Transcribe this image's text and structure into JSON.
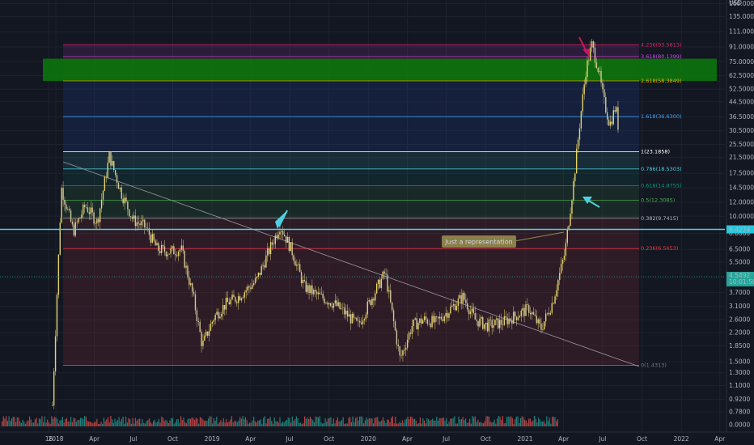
{
  "chart_data": {
    "type": "candlestick",
    "price_axis": {
      "scale": "log",
      "currency": "USD",
      "range": [
        0.72,
        200
      ],
      "tick_labels": [
        "160.0000",
        "135.0000",
        "111.0000",
        "91.0000",
        "75.0000",
        "62.5000",
        "52.5000",
        "44.5000",
        "36.5000",
        "30.5000",
        "25.5000",
        "21.5000",
        "17.5000",
        "14.5000",
        "12.0000",
        "10.0000",
        "8.0000",
        "6.5000",
        "5.5000",
        "4.5000",
        "3.7000",
        "3.1000",
        "2.6000",
        "2.2000",
        "1.8500",
        "1.5000",
        "1.3000",
        "1.1000",
        "0.9200",
        "0.7800",
        "0.0000"
      ],
      "current_price_label": "8.4274",
      "last_price_label": "4.5492",
      "countdown_label": "10:01:50"
    },
    "time_axis": {
      "labels": [
        "16",
        "2018",
        "Apr",
        "Jul",
        "Oct",
        "2019",
        "Apr",
        "Jul",
        "Oct",
        "2020",
        "Apr",
        "Jul",
        "Oct",
        "2021",
        "Apr",
        "Jul",
        "Oct",
        "2022",
        "Apr"
      ]
    },
    "fibonacci": [
      {
        "label": "0(1.4313)",
        "ratio": 0,
        "price": 1.4313,
        "color": "#787b86"
      },
      {
        "label": "0.236(6.5653)",
        "ratio": 0.236,
        "price": 6.5653,
        "color": "#f23645"
      },
      {
        "label": "0.382(9.7415)",
        "ratio": 0.382,
        "price": 9.7415,
        "color": "#b2b5be"
      },
      {
        "label": "0.5(12.3085)",
        "ratio": 0.5,
        "price": 12.3085,
        "color": "#4caf50"
      },
      {
        "label": "0.618(14.8755)",
        "ratio": 0.618,
        "price": 14.8755,
        "color": "#089981"
      },
      {
        "label": "0.786(18.5303)",
        "ratio": 0.786,
        "price": 18.5303,
        "color": "#4dd0e1"
      },
      {
        "label": "1(23.1858)",
        "ratio": 1,
        "price": 23.1858,
        "color": "#ffffff"
      },
      {
        "label": "1.618(36.6300)",
        "ratio": 1.618,
        "price": 36.63,
        "color": "#42a5f5"
      },
      {
        "label": "2.618(58.3849)",
        "ratio": 2.618,
        "price": 58.3849,
        "color": "#f7a600"
      },
      {
        "label": "3.618(80.1399)",
        "ratio": 3.618,
        "price": 80.1399,
        "color": "#e040fb"
      },
      {
        "label": "4.236(93.5813)",
        "ratio": 4.236,
        "price": 93.5813,
        "color": "#e91e63"
      }
    ],
    "support_zone": {
      "low": 58.3849,
      "high": 78
    },
    "horizontal_line_price": 8.4274,
    "annotation": "Just a representation",
    "series": [
      {
        "name": "",
        "points": [
          [
            "2017-12-24",
            0.85
          ],
          [
            "2018-01-14",
            14.5
          ],
          [
            "2018-02-11",
            8.2
          ],
          [
            "2018-03-11",
            11.5
          ],
          [
            "2018-04-08",
            9.2
          ],
          [
            "2018-05-06",
            22.0
          ],
          [
            "2018-06-03",
            13.5
          ],
          [
            "2018-07-01",
            9.5
          ],
          [
            "2018-07-29",
            8.7
          ],
          [
            "2018-08-26",
            6.5
          ],
          [
            "2018-09-23",
            6.3
          ],
          [
            "2018-10-21",
            6.5
          ],
          [
            "2018-11-18",
            3.5
          ],
          [
            "2018-12-09",
            1.85
          ],
          [
            "2019-01-06",
            2.7
          ],
          [
            "2019-02-03",
            3.2
          ],
          [
            "2019-03-03",
            3.5
          ],
          [
            "2019-04-14",
            4.3
          ],
          [
            "2019-05-12",
            6.2
          ],
          [
            "2019-06-09",
            8.9
          ],
          [
            "2019-07-07",
            6.3
          ],
          [
            "2019-08-04",
            4.0
          ],
          [
            "2019-09-01",
            3.6
          ],
          [
            "2019-10-13",
            3.2
          ],
          [
            "2019-11-10",
            2.8
          ],
          [
            "2019-12-08",
            2.4
          ],
          [
            "2020-01-05",
            3.3
          ],
          [
            "2020-02-09",
            4.8
          ],
          [
            "2020-03-15",
            1.55
          ],
          [
            "2020-04-12",
            2.4
          ],
          [
            "2020-05-10",
            2.6
          ],
          [
            "2020-06-07",
            2.5
          ],
          [
            "2020-07-05",
            2.9
          ],
          [
            "2020-08-09",
            3.5
          ],
          [
            "2020-09-06",
            2.6
          ],
          [
            "2020-10-04",
            2.4
          ],
          [
            "2020-11-08",
            2.5
          ],
          [
            "2020-12-06",
            2.7
          ],
          [
            "2021-01-10",
            3.0
          ],
          [
            "2021-02-07",
            2.3
          ],
          [
            "2021-03-07",
            3.3
          ],
          [
            "2021-04-04",
            6.2
          ],
          [
            "2021-04-25",
            16.0
          ],
          [
            "2021-05-09",
            34.0
          ],
          [
            "2021-05-23",
            67.0
          ],
          [
            "2021-06-06",
            93.6
          ],
          [
            "2021-06-20",
            70.0
          ],
          [
            "2021-07-04",
            45.0
          ],
          [
            "2021-07-18",
            33.0
          ],
          [
            "2021-08-01",
            42.0
          ],
          [
            "2021-08-08",
            30.0
          ]
        ]
      }
    ]
  }
}
